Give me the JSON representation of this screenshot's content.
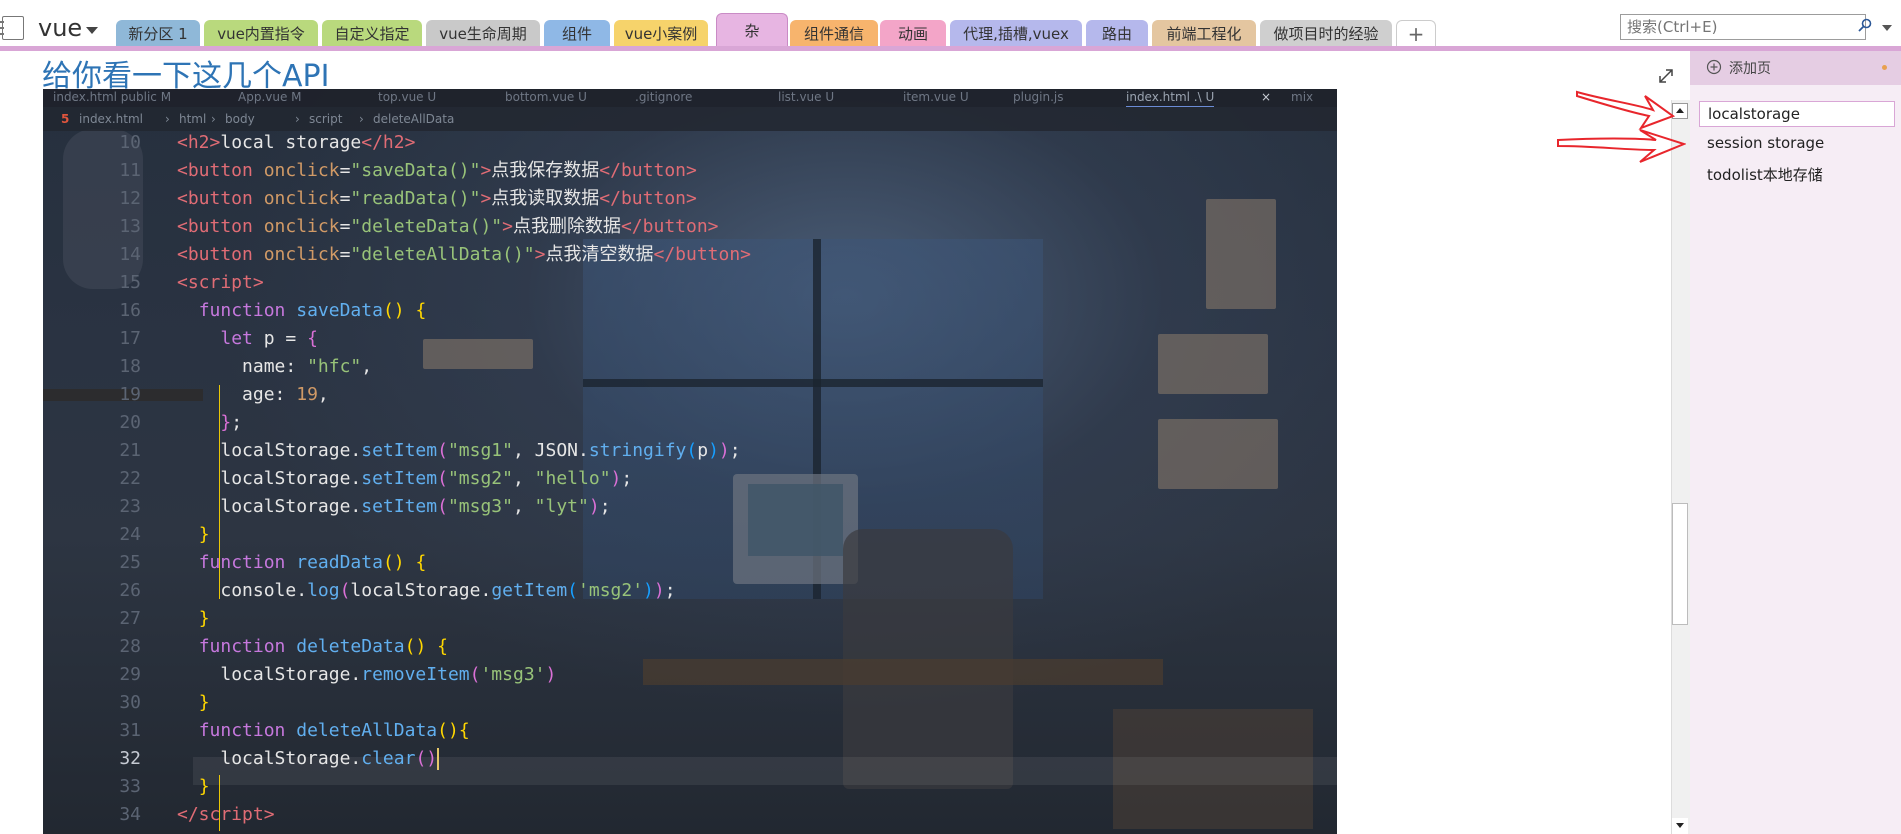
{
  "notebook": {
    "title": "vue"
  },
  "section_tabs": [
    {
      "label": "新分区 1",
      "color": "#8fb8d8"
    },
    {
      "label": "vue内置指令",
      "color": "#b9d97d"
    },
    {
      "label": "自定义指定",
      "color": "#b9d97d"
    },
    {
      "label": "vue生命周期",
      "color": "#c9c9c9"
    },
    {
      "label": "组件",
      "color": "#8fb8e6"
    },
    {
      "label": "vue小案例",
      "color": "#f6d36b"
    },
    {
      "label": "杂",
      "color": "#e7b5e2"
    },
    {
      "label": "组件通信",
      "color": "#f7b46d"
    },
    {
      "label": "动画",
      "color": "#f3a5c8"
    },
    {
      "label": "代理,插槽,vuex",
      "color": "#b5b8ec"
    },
    {
      "label": "路由",
      "color": "#b5b8ec"
    },
    {
      "label": "前端工程化",
      "color": "#e4c6a0"
    },
    {
      "label": "做项目时的经验",
      "color": "#cfcfcf"
    }
  ],
  "add_section_label": "+",
  "search": {
    "placeholder": "搜索(Ctrl+E)"
  },
  "page": {
    "title": "给你看一下这几个API"
  },
  "editor": {
    "file_tabs": [
      "index.html public M",
      "App.vue M",
      "top.vue U",
      "bottom.vue U",
      ".gitignore",
      "list.vue U",
      "item.vue U",
      "plugin.js",
      "index.html .\\ U",
      "mix"
    ],
    "breadcrumb": [
      "index.html",
      "html",
      "body",
      "script",
      "deleteAllData"
    ],
    "lines": [
      {
        "n": "10",
        "html": "<span class='tag'>&lt;h2&gt;</span><span class='plain'>local storage</span><span class='tag'>&lt;/h2&gt;</span>"
      },
      {
        "n": "11",
        "html": "<span class='tag'>&lt;button</span> <span class='attr'>onclick</span><span class='plain'>=</span><span class='str'>\"saveData()\"</span><span class='tag'>&gt;</span><span class='plain'>点我保存数据</span><span class='tag'>&lt;/button&gt;</span>"
      },
      {
        "n": "12",
        "html": "<span class='tag'>&lt;button</span> <span class='attr'>onclick</span><span class='plain'>=</span><span class='str'>\"readData()\"</span><span class='tag'>&gt;</span><span class='plain'>点我读取数据</span><span class='tag'>&lt;/button&gt;</span>"
      },
      {
        "n": "13",
        "html": "<span class='tag'>&lt;button</span> <span class='attr'>onclick</span><span class='plain'>=</span><span class='str'>\"deleteData()\"</span><span class='tag'>&gt;</span><span class='plain'>点我删除数据</span><span class='tag'>&lt;/button&gt;</span>"
      },
      {
        "n": "14",
        "html": "<span class='tag'>&lt;button</span> <span class='attr'>onclick</span><span class='plain'>=</span><span class='str'>\"deleteAllData()\"</span><span class='tag'>&gt;</span><span class='plain'>点我清空数据</span><span class='tag'>&lt;/button&gt;</span>"
      },
      {
        "n": "15",
        "html": "<span class='tag'>&lt;script&gt;</span>"
      },
      {
        "n": "16",
        "html": "  <span class='kw'>function</span> <span class='fn'>saveData</span><span class='br1'>()</span> <span class='br1'>{</span>"
      },
      {
        "n": "17",
        "html": "    <span class='kw'>let</span> <span class='plain'>p</span> <span class='plain'>=</span> <span class='br2'>{</span>"
      },
      {
        "n": "18",
        "html": "      <span class='plain'>name:</span> <span class='str'>\"hfc\"</span><span class='plain'>,</span>"
      },
      {
        "n": "19",
        "html": "      <span class='plain'>age:</span> <span class='num'>19</span><span class='plain'>,</span>"
      },
      {
        "n": "20",
        "html": "    <span class='br2'>}</span><span class='plain'>;</span>"
      },
      {
        "n": "21",
        "html": "    <span class='plain'>localStorage.</span><span class='fn'>setItem</span><span class='br2'>(</span><span class='str'>\"msg1\"</span><span class='plain'>, JSON.</span><span class='fn'>stringify</span><span class='br3'>(</span><span class='plain'>p</span><span class='br3'>)</span><span class='br2'>)</span><span class='plain'>;</span>"
      },
      {
        "n": "22",
        "html": "    <span class='plain'>localStorage.</span><span class='fn'>setItem</span><span class='br2'>(</span><span class='str'>\"msg2\"</span><span class='plain'>, </span><span class='str'>\"hello\"</span><span class='br2'>)</span><span class='plain'>;</span>"
      },
      {
        "n": "23",
        "html": "    <span class='plain'>localStorage.</span><span class='fn'>setItem</span><span class='br2'>(</span><span class='str'>\"msg3\"</span><span class='plain'>, </span><span class='str'>\"lyt\"</span><span class='br2'>)</span><span class='plain'>;</span>"
      },
      {
        "n": "24",
        "html": "  <span class='br1'>}</span>"
      },
      {
        "n": "25",
        "html": "  <span class='kw'>function</span> <span class='fn'>readData</span><span class='br1'>()</span> <span class='br1'>{</span>"
      },
      {
        "n": "26",
        "html": "    <span class='plain'>console.</span><span class='fn'>log</span><span class='br2'>(</span><span class='plain'>localStorage.</span><span class='fn'>getItem</span><span class='br3'>(</span><span class='str'>'msg2'</span><span class='br3'>)</span><span class='br2'>)</span><span class='plain'>;</span>"
      },
      {
        "n": "27",
        "html": "  <span class='br1'>}</span>"
      },
      {
        "n": "28",
        "html": "  <span class='kw'>function</span> <span class='fn'>deleteData</span><span class='br1'>()</span> <span class='br1'>{</span>"
      },
      {
        "n": "29",
        "html": "    <span class='plain'>localStorage.</span><span class='fn'>removeItem</span><span class='br2'>(</span><span class='str'>'msg3'</span><span class='br2'>)</span>"
      },
      {
        "n": "30",
        "html": "  <span class='br1'>}</span>"
      },
      {
        "n": "31",
        "html": "  <span class='kw'>function</span> <span class='fn'>deleteAllData</span><span class='br1'>()</span><span class='br1'>{</span>"
      },
      {
        "n": "32",
        "html": "    <span class='plain'>localStorage.</span><span class='fn'>clear</span><span class='br2'>()</span><span class='cursor'></span>",
        "current": true
      },
      {
        "n": "33",
        "html": "  <span class='br1'>}</span>"
      },
      {
        "n": "34",
        "html": "<span class='tag'>&lt;/script&gt;</span>"
      }
    ]
  },
  "page_list": {
    "add_page_label": "添加页",
    "items": [
      {
        "label": "localstorage",
        "selected": true
      },
      {
        "label": "session storage",
        "selected": false
      },
      {
        "label": "todolist本地存储",
        "selected": false
      }
    ]
  },
  "colors": {
    "accent": "#d9a6d6",
    "page_title": "#2e74b5",
    "annotation_arrow": "#e8262c"
  }
}
